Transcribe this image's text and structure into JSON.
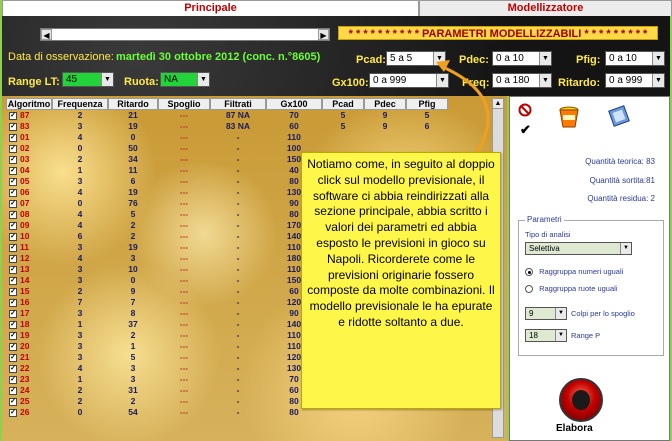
{
  "tabs": [
    {
      "label": "Principale",
      "active": true
    },
    {
      "label": "Modellizzatore",
      "active": false
    }
  ],
  "header": {
    "param_title": "* * * * * * * * * * PARAMETRI MODELLIZZABILI * * * * * * * * *",
    "date_label": "Data di osservazione:",
    "date_value": "martedì 30 ottobre 2012 (conc. n.°8605)",
    "range_lt_label": "Range LT:",
    "range_lt_value": "45",
    "ruota_label": "Ruota:",
    "ruota_value": "NA",
    "pcad_label": "Pcad:",
    "pcad_value": "5 a 5",
    "pdec_label": "Pdec:",
    "pdec_value": "0 a 10",
    "pfig_label": "Pfig:",
    "pfig_value": "0 a 10",
    "gx100_label": "Gx100:",
    "gx100_value": "0 a 999",
    "freq_label": "Freq:",
    "freq_value": "0 a 180",
    "ritardo_label": "Ritardo:",
    "ritardo_value": "0 a 999"
  },
  "table": {
    "columns": [
      "Algoritmo",
      "Frequenza",
      "Ritardo",
      "Spoglio",
      "Filtrati",
      "Gx100",
      "Pcad",
      "Pdec",
      "Pfig"
    ],
    "rows": [
      [
        "87",
        "2",
        "21",
        "---",
        "87 NA",
        "70",
        "5",
        "9",
        "5"
      ],
      [
        "83",
        "3",
        "19",
        "---",
        "83 NA",
        "60",
        "5",
        "9",
        "6"
      ],
      [
        "01",
        "4",
        "0",
        "---",
        "-",
        "110",
        "",
        "",
        ""
      ],
      [
        "02",
        "0",
        "50",
        "---",
        "-",
        "100",
        "",
        "",
        ""
      ],
      [
        "03",
        "2",
        "34",
        "---",
        "-",
        "150",
        "",
        "",
        ""
      ],
      [
        "04",
        "1",
        "11",
        "---",
        "-",
        "40",
        "",
        "",
        ""
      ],
      [
        "05",
        "3",
        "6",
        "---",
        "-",
        "80",
        "",
        "",
        ""
      ],
      [
        "06",
        "4",
        "19",
        "---",
        "-",
        "130",
        "",
        "",
        ""
      ],
      [
        "07",
        "0",
        "76",
        "---",
        "-",
        "90",
        "",
        "",
        ""
      ],
      [
        "08",
        "4",
        "5",
        "---",
        "-",
        "80",
        "",
        "",
        ""
      ],
      [
        "09",
        "4",
        "2",
        "---",
        "-",
        "170",
        "",
        "",
        ""
      ],
      [
        "10",
        "6",
        "2",
        "---",
        "-",
        "140",
        "",
        "",
        ""
      ],
      [
        "11",
        "3",
        "19",
        "---",
        "-",
        "110",
        "",
        "",
        ""
      ],
      [
        "12",
        "4",
        "3",
        "---",
        "-",
        "180",
        "",
        "",
        ""
      ],
      [
        "13",
        "3",
        "10",
        "---",
        "-",
        "110",
        "",
        "",
        ""
      ],
      [
        "14",
        "3",
        "0",
        "---",
        "-",
        "150",
        "",
        "",
        ""
      ],
      [
        "15",
        "2",
        "9",
        "---",
        "-",
        "60",
        "",
        "",
        ""
      ],
      [
        "16",
        "7",
        "7",
        "---",
        "-",
        "120",
        "",
        "",
        ""
      ],
      [
        "17",
        "3",
        "8",
        "---",
        "-",
        "90",
        "",
        "",
        ""
      ],
      [
        "18",
        "1",
        "37",
        "---",
        "-",
        "140",
        "",
        "",
        ""
      ],
      [
        "19",
        "3",
        "2",
        "---",
        "-",
        "110",
        "",
        "",
        ""
      ],
      [
        "20",
        "3",
        "1",
        "---",
        "-",
        "110",
        "",
        "",
        ""
      ],
      [
        "21",
        "3",
        "5",
        "---",
        "-",
        "120",
        "",
        "",
        ""
      ],
      [
        "22",
        "4",
        "3",
        "---",
        "-",
        "130",
        "",
        "",
        ""
      ],
      [
        "23",
        "1",
        "3",
        "---",
        "-",
        "70",
        "",
        "",
        ""
      ],
      [
        "24",
        "2",
        "31",
        "---",
        "-",
        "60",
        "",
        "",
        ""
      ],
      [
        "25",
        "2",
        "2",
        "---",
        "-",
        "80",
        "",
        "",
        ""
      ],
      [
        "26",
        "0",
        "54",
        "---",
        "-",
        "80",
        "",
        "",
        ""
      ]
    ]
  },
  "right_panel": {
    "quantita_teorica": "Quantità teorica: 83",
    "quantita_sortita": "Quantità sortita:81",
    "quantita_residua": "Quantità residua: 2",
    "parametri_title": "Parametri",
    "tipo_analisi_label": "Tipo di analisi",
    "tipo_analisi_value": "Selettiva",
    "radio1": "Raggruppa numeri uguali",
    "radio2": "Raggruppa ruote uguali",
    "colpi_value": "9",
    "colpi_label": "Colpi per lo spoglio",
    "range_p_value": "18",
    "range_p_label": "Range P",
    "elabora_label": "Elabora"
  },
  "callout": {
    "text": "Notiamo come, in seguito al doppio click sul modello previsionale, il software ci abbia reindirizzati alla sezione principale, abbia scritto i valori dei parametri ed abbia esposto le previsioni in gioco su Napoli. Ricorderete come le previsioni originarie fossero composte da molte combinazioni. Il modello previsionale le ha epurate e ridotte soltanto a due."
  },
  "colors": {
    "frame_green": "#8fd14f",
    "tab_red": "#c00000",
    "label_yellow": "#ffe94a",
    "callout_yellow": "#fff64a",
    "arrow_orange": "#f0a020"
  }
}
